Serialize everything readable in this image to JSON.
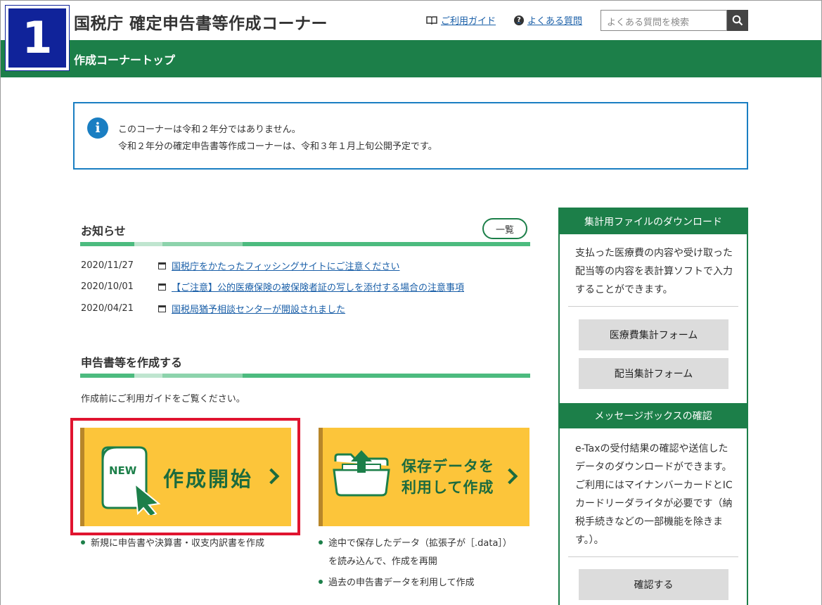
{
  "step": {
    "number": "1"
  },
  "header": {
    "title": "国税庁 確定申告書等作成コーナー",
    "guide_link": "ご利用ガイド",
    "faq_link": "よくある質問",
    "search_placeholder": "よくある質問を検索",
    "breadcrumb": "作成コーナートップ"
  },
  "notice": {
    "line1": "このコーナーは令和２年分ではありません。",
    "line2": "令和２年分の確定申告書等作成コーナーは、令和３年１月上旬公開予定です。"
  },
  "news": {
    "title": "お知らせ",
    "list_button": "一覧",
    "items": [
      {
        "date": "2020/11/27",
        "text": "国税庁をかたったフィッシングサイトにご注意ください"
      },
      {
        "date": "2020/10/01",
        "text": "【ご注意】公的医療保険の被保険者証の写しを添付する場合の注意事項"
      },
      {
        "date": "2020/04/21",
        "text": "国税局猶予相談センターが開設されました"
      }
    ]
  },
  "create": {
    "title": "申告書等を作成する",
    "guide_text": "作成前にご利用ガイドをご覧ください。",
    "start_button": {
      "label": "作成開始",
      "badge": "NEW"
    },
    "reuse_button": {
      "label_line1": "保存データを",
      "label_line2": "利用して作成"
    },
    "start_bullets": [
      "新規に申告書や決算書・収支内訳書を作成"
    ],
    "reuse_bullets": [
      "途中で保存したデータ（拡張子が［.data］）",
      "を読み込んで、作成を再開",
      "過去の申告書データを利用して作成"
    ]
  },
  "sidebar": {
    "download_header": "集計用ファイルのダウンロード",
    "download_text": "支払った医療費の内容や受け取った配当等の内容を表計算ソフトで入力することができます。",
    "medical_button": "医療費集計フォーム",
    "dividend_button": "配当集計フォーム",
    "message_header": "メッセージボックスの確認",
    "message_text": "e-Taxの受付結果の確認や送信したデータのダウンロードができます。ご利用にはマイナンバーカードとICカードリーダライタが必要です（納税手続きなどの一部機能を除きます。）。",
    "confirm_button": "確認する"
  },
  "colors": {
    "green": "#1c7f49",
    "blue": "#1a7ec2",
    "yellow": "#fcc53a",
    "red": "#e0142f",
    "navy": "#10239a"
  }
}
